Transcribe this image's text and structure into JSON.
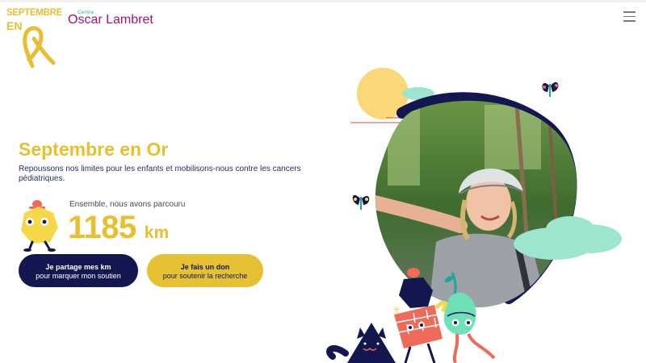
{
  "logos": {
    "septembre_line1": "SEPTEMBRE",
    "septembre_line2": "EN",
    "centre_label": "Centre",
    "centre_name": "Oscar Lambret"
  },
  "header": {
    "menu_icon": "hamburger-menu-icon"
  },
  "hero": {
    "title": "Septembre en Or",
    "subtitle": "Repoussons nos limites pour les enfants et mobilisons-nous contre les cancers pédiatriques.",
    "together_label": "Ensemble, nous avons parcouru",
    "distance_value": "1185",
    "distance_unit": "km"
  },
  "buttons": {
    "share": {
      "line1": "Je partage mes km",
      "line2": "pour marquer mon soutien"
    },
    "donate": {
      "line1": "Je fais un don",
      "line2": "pour soutenir la recherche"
    }
  },
  "colors": {
    "gold": "#e8bf2e",
    "navy": "#141650",
    "magenta": "#a3127a",
    "teal": "#1aa89c",
    "mint": "#8ee6d2",
    "coral": "#f06a5a"
  }
}
